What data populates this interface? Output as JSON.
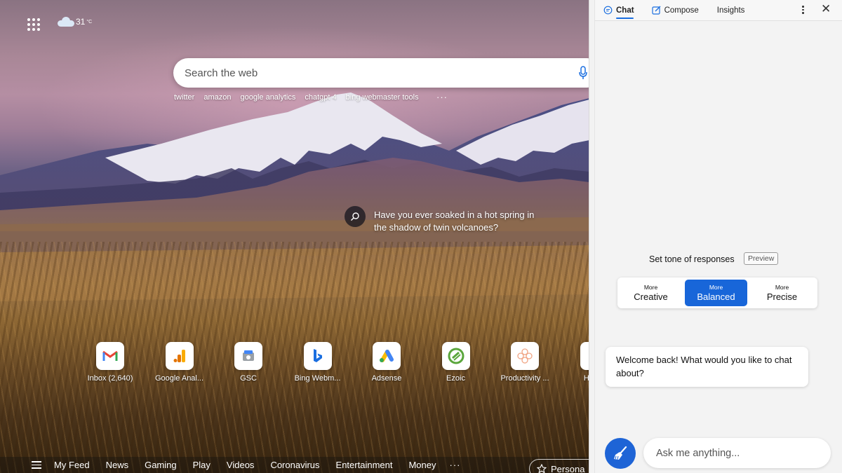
{
  "weather": {
    "temperature": "31",
    "unit": "°C",
    "icon": "cloud-icon"
  },
  "search": {
    "placeholder": "Search the web"
  },
  "suggestions": [
    "twitter",
    "amazon",
    "google analytics",
    "chatgpt 4",
    "bing webmaster tools"
  ],
  "suggestions_more": "···",
  "background_prompt": "Have you ever soaked in a hot spring in the shadow of twin volcanoes?",
  "tiles": [
    {
      "label": "Inbox (2,640)",
      "icon": "gmail-icon"
    },
    {
      "label": "Google Anal...",
      "icon": "google-analytics-icon"
    },
    {
      "label": "GSC",
      "icon": "gsc-icon"
    },
    {
      "label": "Bing Webm...",
      "icon": "bing-icon"
    },
    {
      "label": "Adsense",
      "icon": "adsense-icon"
    },
    {
      "label": "Ezoic",
      "icon": "ezoic-icon"
    },
    {
      "label": "Productivity ...",
      "icon": "productivity-icon"
    },
    {
      "label": "Home",
      "icon": "home-tile-icon"
    }
  ],
  "feed": {
    "items": [
      "My Feed",
      "News",
      "Gaming",
      "Play",
      "Videos",
      "Coronavirus",
      "Entertainment",
      "Money"
    ],
    "more": "···",
    "personalize": "Persona"
  },
  "panel": {
    "tabs": [
      {
        "label": "Chat",
        "icon": "chat-icon",
        "active": true
      },
      {
        "label": "Compose",
        "icon": "compose-icon",
        "active": false
      },
      {
        "label": "Insights",
        "icon": "",
        "active": false
      }
    ],
    "tone_label": "Set tone of responses",
    "preview_badge": "Preview",
    "tones": [
      {
        "small": "More",
        "big": "Creative",
        "active": false
      },
      {
        "small": "More",
        "big": "Balanced",
        "active": true
      },
      {
        "small": "More",
        "big": "Precise",
        "active": false
      }
    ],
    "welcome": "Welcome back! What would you like to chat about?",
    "ask_placeholder": "Ask me anything...",
    "accent_color": "#1866d9"
  }
}
